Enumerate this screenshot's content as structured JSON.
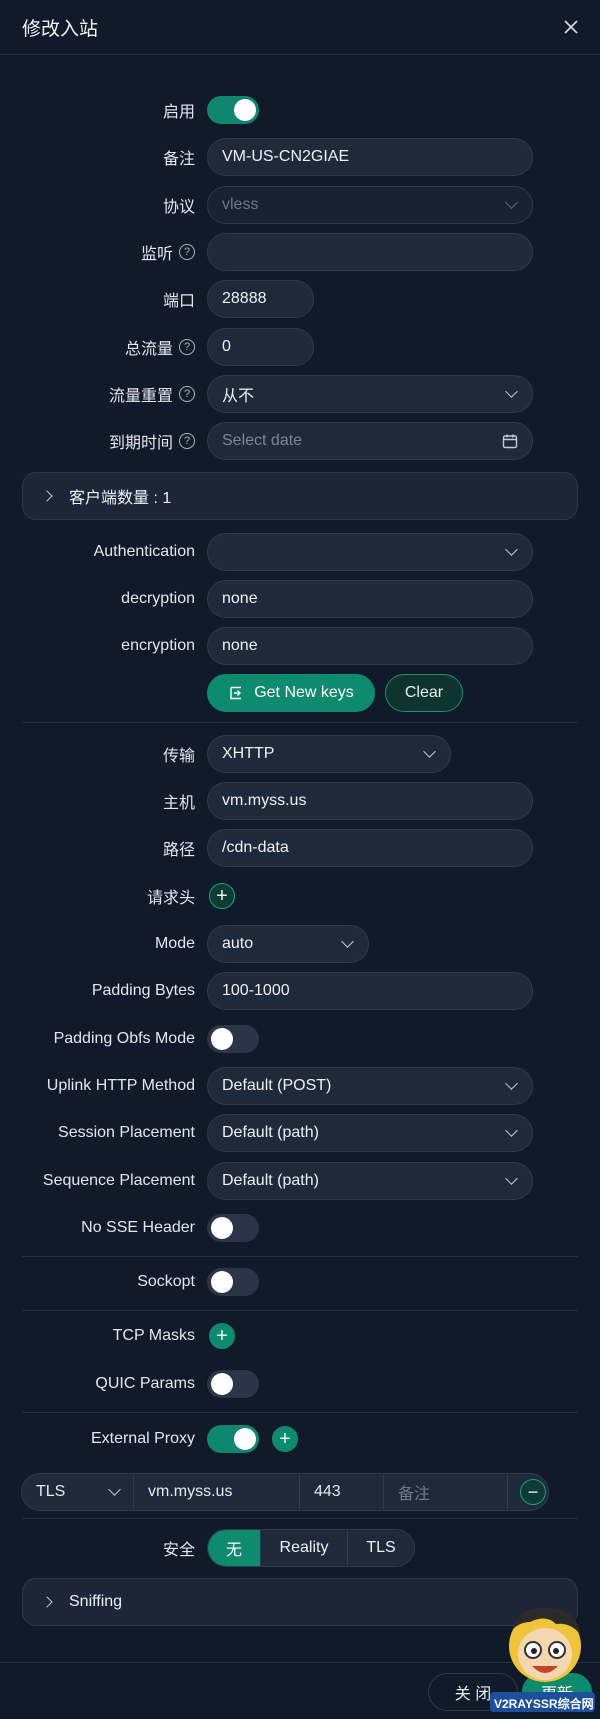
{
  "modal": {
    "title": "修改入站"
  },
  "fields": {
    "enable": {
      "label": "启用",
      "on": true
    },
    "remark": {
      "label": "备注",
      "value": "VM-US-CN2GIAE"
    },
    "protocol": {
      "label": "协议",
      "value": "vless"
    },
    "listen": {
      "label": "监听",
      "value": ""
    },
    "port": {
      "label": "端口",
      "value": "28888"
    },
    "total_traffic": {
      "label": "总流量",
      "value": "0"
    },
    "traffic_reset": {
      "label": "流量重置",
      "value": "从不"
    },
    "expiry": {
      "label": "到期时间",
      "placeholder": "Select date"
    }
  },
  "clients": {
    "label": "客户端数量 : 1"
  },
  "auth": {
    "authentication": {
      "label": "Authentication",
      "value": ""
    },
    "decryption": {
      "label": "decryption",
      "value": "none"
    },
    "encryption": {
      "label": "encryption",
      "value": "none"
    },
    "get_keys": "Get New keys",
    "clear": "Clear"
  },
  "transport": {
    "transport": {
      "label": "传输",
      "value": "XHTTP"
    },
    "host": {
      "label": "主机",
      "value": "vm.myss.us"
    },
    "path": {
      "label": "路径",
      "value": "/cdn-data"
    },
    "headers": {
      "label": "请求头"
    },
    "mode": {
      "label": "Mode",
      "value": "auto"
    },
    "padding_bytes": {
      "label": "Padding Bytes",
      "value": "100-1000"
    },
    "padding_obfs": {
      "label": "Padding Obfs Mode",
      "on": false
    },
    "uplink": {
      "label": "Uplink HTTP Method",
      "value": "Default (POST)"
    },
    "session": {
      "label": "Session Placement",
      "value": "Default (path)"
    },
    "sequence": {
      "label": "Sequence Placement",
      "value": "Default (path)"
    },
    "no_sse": {
      "label": "No SSE Header",
      "on": false
    }
  },
  "sockopt": {
    "label": "Sockopt",
    "on": false
  },
  "tcp_masks": {
    "label": "TCP Masks"
  },
  "quic": {
    "label": "QUIC Params",
    "on": false
  },
  "external_proxy": {
    "label": "External Proxy",
    "on": true,
    "row": {
      "type": "TLS",
      "host": "vm.myss.us",
      "port": "443",
      "remark_placeholder": "备注"
    }
  },
  "security": {
    "label": "安全",
    "options": [
      "无",
      "Reality",
      "TLS"
    ],
    "selected": "无"
  },
  "sniffing": {
    "label": "Sniffing"
  },
  "footer": {
    "close": "关 闭",
    "update": "更新"
  },
  "watermark": {
    "text": "V2RAYSSR综合网"
  },
  "colors": {
    "accent": "#0e8a6d",
    "background": "#111a28",
    "input": "#1e293a"
  }
}
